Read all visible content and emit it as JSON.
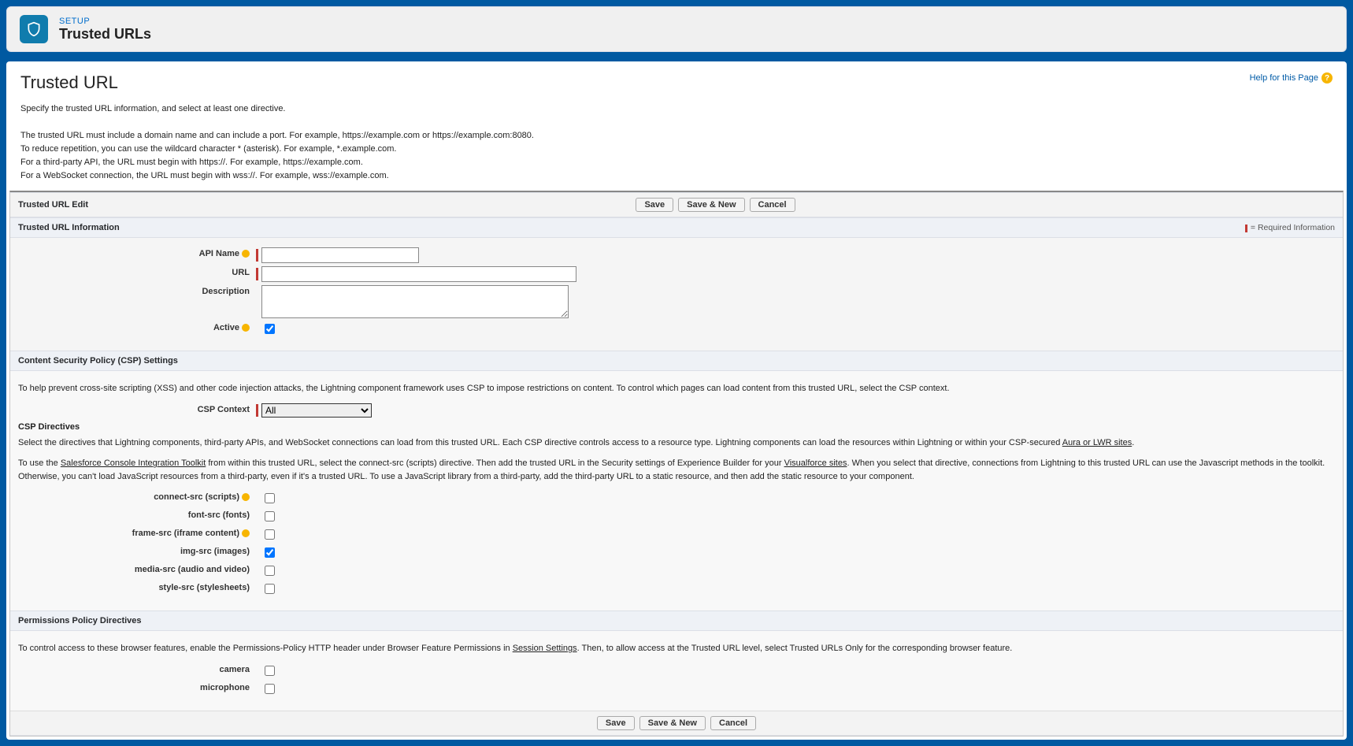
{
  "header": {
    "setup_label": "SETUP",
    "title": "Trusted URLs"
  },
  "page": {
    "title": "Trusted URL",
    "help_link": "Help for this Page"
  },
  "intro": {
    "line1": "Specify the trusted URL information, and select at least one directive.",
    "line2": "The trusted URL must include a domain name and can include a port. For example, https://example.com or https://example.com:8080.",
    "line3": "To reduce repetition, you can use the wildcard character * (asterisk). For example, *.example.com.",
    "line4": "For a third-party API, the URL must begin with https://. For example, https://example.com.",
    "line5": "For a WebSocket connection, the URL must begin with wss://. For example, wss://example.com."
  },
  "edit_bar": {
    "title": "Trusted URL Edit",
    "save": "Save",
    "save_new": "Save & New",
    "cancel": "Cancel"
  },
  "info_section": {
    "heading": "Trusted URL Information",
    "required_text": "= Required Information",
    "fields": {
      "api_name_label": "API Name",
      "api_name_value": "",
      "url_label": "URL",
      "url_value": "",
      "description_label": "Description",
      "description_value": "",
      "active_label": "Active",
      "active_checked": true
    }
  },
  "csp_section": {
    "heading": "Content Security Policy (CSP) Settings",
    "help_text": "To help prevent cross-site scripting (XSS) and other code injection attacks, the Lightning component framework uses CSP to impose restrictions on content. To control which pages can load content from this trusted URL, select the CSP context.",
    "context_label": "CSP Context",
    "context_value": "All",
    "directives_title": "CSP Directives",
    "directives_help_part1": "Select the directives that Lightning components, third-party APIs, and WebSocket connections can load from this trusted URL. Each CSP directive controls access to a resource type. Lightning components can load the resources within Lightning or within your CSP-secured ",
    "aura_link": "Aura or LWR sites",
    "directives_help_part2a": "To use the ",
    "console_link": "Salesforce Console Integration Toolkit",
    "directives_help_part2b": " from within this trusted URL, select the connect-src (scripts) directive. Then add the trusted URL in the Security settings of Experience Builder for your ",
    "vf_link": "Visualforce sites",
    "directives_help_part2c": ". When you select that directive, connections from Lightning to this trusted URL can use the Javascript methods in the toolkit. Otherwise, you can't load JavaScript resources from a third-party, even if it's a trusted URL. To use a JavaScript library from a third-party, add the third-party URL to a static resource, and then add the static resource to your component.",
    "directives": {
      "connect_src": {
        "label": "connect-src (scripts)",
        "checked": false
      },
      "font_src": {
        "label": "font-src (fonts)",
        "checked": false
      },
      "frame_src": {
        "label": "frame-src (iframe content)",
        "checked": false
      },
      "img_src": {
        "label": "img-src (images)",
        "checked": true
      },
      "media_src": {
        "label": "media-src (audio and video)",
        "checked": false
      },
      "style_src": {
        "label": "style-src (stylesheets)",
        "checked": false
      }
    }
  },
  "perm_section": {
    "heading": "Permissions Policy Directives",
    "help_part1": "To control access to these browser features, enable the Permissions-Policy HTTP header under Browser Feature Permissions in ",
    "session_link": "Session Settings",
    "help_part2": ". Then, to allow access at the Trusted URL level, select Trusted URLs Only for the corresponding browser feature.",
    "fields": {
      "camera_label": "camera",
      "camera_checked": false,
      "microphone_label": "microphone",
      "microphone_checked": false
    }
  }
}
